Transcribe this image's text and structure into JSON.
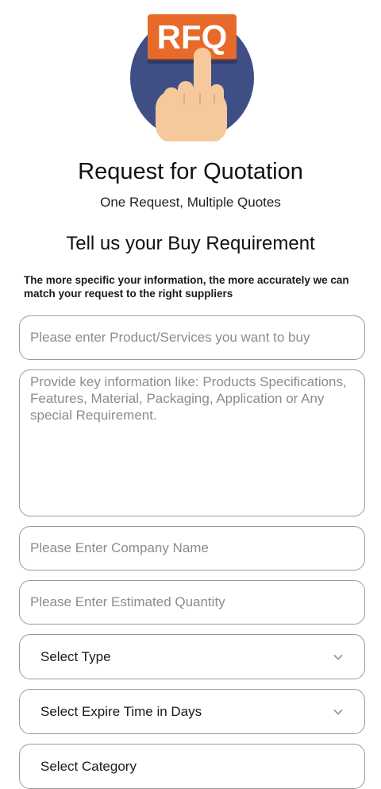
{
  "logo": {
    "text": "RFQ",
    "icon": "rfq-hand-pointer-icon",
    "colors": {
      "circle": "#3f4f86",
      "badge": "#e86a2a",
      "hand": "#f5c99b"
    }
  },
  "header": {
    "title": "Request for Quotation",
    "subtitle": "One Request, Multiple Quotes"
  },
  "form": {
    "heading": "Tell us your Buy Requirement",
    "note": "The more specific your information, the more accurately we can match your request to the right suppliers",
    "product_placeholder": "Please enter Product/Services you want to buy",
    "details_placeholder": "Provide key information like: Products Specifications, Features, Material, Packaging, Application or Any special Requirement.",
    "company_placeholder": "Please Enter Company Name",
    "quantity_placeholder": "Please Enter Estimated Quantity",
    "type_label": "Select Type",
    "expire_label": "Select Expire Time in Days",
    "category_label": "Select Category"
  }
}
